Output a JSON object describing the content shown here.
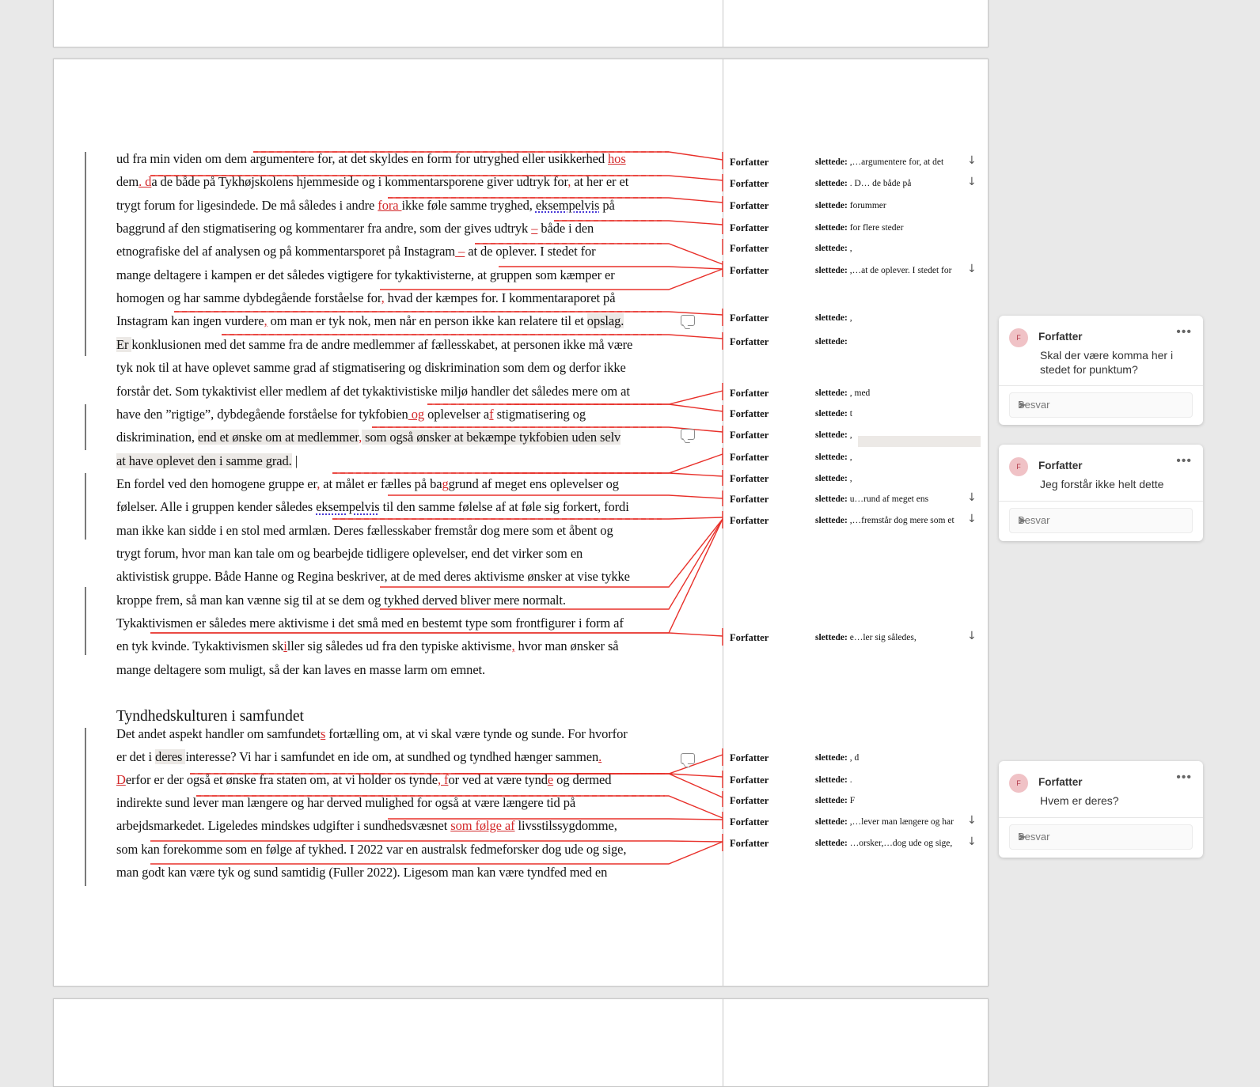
{
  "body_lines": [
    {
      "segs": [
        {
          "t": "ud fra min viden om dem argumentere for, at det skyldes en form for utryghed eller usikkerhed "
        },
        {
          "t": "hos",
          "s": "ins"
        }
      ]
    },
    {
      "segs": [
        {
          "t": "dem"
        },
        {
          "t": ". d",
          "s": "ins"
        },
        {
          "t": "a de både på Tykhøjskolens hjemmeside og i kommentarsporene giver udtryk for"
        },
        {
          "t": ",",
          "s": "ins"
        },
        {
          "t": " at her er et"
        }
      ]
    },
    {
      "segs": [
        {
          "t": "trygt forum for ligesindede. De må således i andre "
        },
        {
          "t": "fora ",
          "s": "ins"
        },
        {
          "t": "ikke føle samme tryghed, "
        },
        {
          "t": "eksempelvis",
          "s": "dot"
        },
        {
          "t": " på"
        }
      ]
    },
    {
      "segs": [
        {
          "t": "baggrund af den stigmatisering og kommentarer fra andre, som der gives udtryk "
        },
        {
          "t": "–",
          "s": "ins"
        },
        {
          "t": " både i den"
        }
      ]
    },
    {
      "segs": [
        {
          "t": "etnografiske del af analysen og på kommentarsporet på Instagram"
        },
        {
          "t": " –",
          "s": "ins"
        },
        {
          "t": " at de oplever. I stedet for"
        }
      ]
    },
    {
      "segs": [
        {
          "t": "mange deltagere i kampen er det således vigtigere for tykaktivisterne, at gruppen som kæmper er"
        }
      ]
    },
    {
      "segs": [
        {
          "t": "homogen og har samme dybdegående forståelse for"
        },
        {
          "t": ",",
          "s": "ins"
        },
        {
          "t": " hvad der kæmpes for. I kommentaraporet på"
        }
      ]
    },
    {
      "segs": [
        {
          "t": "Instagram kan ingen vurdere"
        },
        {
          "t": ",",
          "s": "ins"
        },
        {
          "t": " om man er tyk nok, men når en person ikke kan relatere til et "
        },
        {
          "t": "opslag.",
          "s": "hl"
        }
      ]
    },
    {
      "segs": [
        {
          "t": "Er ",
          "s": "hl"
        },
        {
          "t": "konklusionen med det samme fra de andre medlemmer af fællesskabet, at personen ikke må være"
        }
      ]
    },
    {
      "segs": [
        {
          "t": "tyk nok til at have oplevet samme grad af stigmatisering og diskrimination som dem og derfor ikke"
        }
      ]
    },
    {
      "segs": [
        {
          "t": "forstår det. Som tykaktivist eller medlem af det tykaktivistiske miljø handler det således mere om at"
        }
      ]
    },
    {
      "segs": [
        {
          "t": "have den ”rigtige”, dybdegående forståelse for tykfobien"
        },
        {
          "t": " og",
          "s": "ins"
        },
        {
          "t": " oplevelser a"
        },
        {
          "t": "f",
          "s": "ins"
        },
        {
          "t": " stigmatisering og"
        }
      ]
    },
    {
      "segs": [
        {
          "t": "diskrimination, "
        },
        {
          "t": "end et ønske om at medlemmer",
          "s": "hl"
        },
        {
          "t": ",",
          "s": "ins"
        },
        {
          "t": " som også ønsker at bekæmpe tykfobien uden selv",
          "s": "hl"
        }
      ]
    },
    {
      "segs": [
        {
          "t": "at have oplevet den i samme grad.",
          "s": "hl"
        },
        {
          "t": " |"
        }
      ]
    },
    {
      "segs": [
        {
          "t": "En fordel ved den homogene gruppe er"
        },
        {
          "t": ",",
          "s": "ins"
        },
        {
          "t": " at målet er fælles på ba"
        },
        {
          "t": "g",
          "s": "ins"
        },
        {
          "t": "grund af meget ens oplevelser og"
        }
      ]
    },
    {
      "segs": [
        {
          "t": "følelser. Alle i gruppen kender således "
        },
        {
          "t": "eksempelvis",
          "s": "dot"
        },
        {
          "t": " til den samme følelse af at føle sig forkert, fordi"
        }
      ]
    },
    {
      "segs": [
        {
          "t": "man ikke kan sidde i en stol med armlæn. Deres fællesskaber fremstår dog mere som et åbent og"
        }
      ]
    },
    {
      "segs": [
        {
          "t": "trygt forum, hvor man kan tale om og bearbejde tidligere oplevelser, end det virker som en"
        }
      ]
    },
    {
      "segs": [
        {
          "t": "aktivistisk gruppe. Både Hanne og Regina beskriver, at de med deres aktivisme ønsker at vise tykke"
        }
      ]
    },
    {
      "segs": [
        {
          "t": "kroppe frem, så man kan vænne sig til at se dem og tykhed derved bliver mere normalt."
        }
      ]
    },
    {
      "segs": [
        {
          "t": "Tykaktivismen er således mere aktivisme i det små med en bestemt type som frontfigurer i form af"
        }
      ]
    },
    {
      "segs": [
        {
          "t": "en tyk kvinde. Tykaktivismen sk"
        },
        {
          "t": "i",
          "s": "ins"
        },
        {
          "t": "ller sig således ud fra den typiske aktivisme"
        },
        {
          "t": ",",
          "s": "ins"
        },
        {
          "t": " hvor man ønsker så"
        }
      ]
    },
    {
      "segs": [
        {
          "t": "mange deltagere som muligt, så der kan laves en masse larm om emnet."
        }
      ]
    }
  ],
  "heading": "Tyndhedskulturen i samfundet",
  "body_lines_2": [
    {
      "segs": [
        {
          "t": "Det andet aspekt handler om samfundet"
        },
        {
          "t": "s",
          "s": "ins"
        },
        {
          "t": " fortælling om, at vi skal være tynde og sunde. For hvorfor"
        }
      ]
    },
    {
      "segs": [
        {
          "t": "er det i "
        },
        {
          "t": "deres ",
          "s": "hl"
        },
        {
          "t": "interesse? Vi har i samfundet en ide om, at sundhed og tyndhed hænger sammen"
        },
        {
          "t": ".",
          "s": "ins"
        }
      ]
    },
    {
      "segs": [
        {
          "t": "D",
          "s": "ins"
        },
        {
          "t": "erfor er der også et ønske fra staten om, at vi holder os tynde"
        },
        {
          "t": ", f",
          "s": "ins"
        },
        {
          "t": "or ved at være tynd"
        },
        {
          "t": "e",
          "s": "ins"
        },
        {
          "t": " og dermed"
        }
      ]
    },
    {
      "segs": [
        {
          "t": "indirekte sund lever man længere og har derved mulighed for også at være længere tid på"
        }
      ]
    },
    {
      "segs": [
        {
          "t": "arbejdsmarkedet. Ligeledes mindskes udgifter i sundhedsvæsnet "
        },
        {
          "t": "som følge af",
          "s": "ins"
        },
        {
          "t": " livsstilssygdomme,"
        }
      ]
    },
    {
      "segs": [
        {
          "t": "som kan forekomme som en følge af tykhed. I 2022 var en australsk fedmeforsker dog ude og sige,"
        }
      ]
    },
    {
      "segs": [
        {
          "t": "man godt kan være tyk og sund samtidig (Fuller 2022). Ligesom man kan være tyndfed med en"
        }
      ]
    }
  ],
  "balloons": [
    {
      "author": "Forfatter",
      "label": "slettede:",
      "text": ",…argumentere for, at det",
      "arrow": true
    },
    {
      "author": "Forfatter",
      "label": "slettede:",
      "text": ". D… de både på",
      "arrow": true
    },
    {
      "author": "Forfatter",
      "label": "slettede:",
      "text": "forummer",
      "arrow": false
    },
    {
      "author": "Forfatter",
      "label": "slettede:",
      "text": " for flere steder",
      "arrow": false
    },
    {
      "author": "Forfatter",
      "label": "slettede:",
      "text": ",",
      "arrow": false
    },
    {
      "author": "Forfatter",
      "label": "slettede:",
      "text": ",…at de oplever. I stedet for",
      "arrow": true
    },
    {
      "author": "Forfatter",
      "label": "slettede:",
      "text": ",",
      "arrow": false
    },
    {
      "author": "Forfatter",
      "label": "slettede:",
      "text": "",
      "arrow": false
    },
    {
      "author": "Forfatter",
      "label": "slettede:",
      "text": ", med",
      "arrow": false
    },
    {
      "author": "Forfatter",
      "label": "slettede:",
      "text": "t",
      "arrow": false
    },
    {
      "author": "Forfatter",
      "label": "slettede:",
      "text": ",",
      "arrow": false
    },
    {
      "author": "Forfatter",
      "label": "slettede:",
      "text": ",",
      "arrow": false
    },
    {
      "author": "Forfatter",
      "label": "slettede:",
      "text": ",",
      "arrow": false
    },
    {
      "author": "Forfatter",
      "label": "slettede:",
      "text": "u…rund af meget ens",
      "arrow": true
    },
    {
      "author": "Forfatter",
      "label": "slettede:",
      "text": ",…fremstår dog mere som et",
      "arrow": true
    },
    {
      "author": "Forfatter",
      "label": "slettede:",
      "text": "e…ler sig således,",
      "arrow": true
    },
    {
      "author": "Forfatter",
      "label": "slettede:",
      "text": ", d",
      "arrow": false
    },
    {
      "author": "Forfatter",
      "label": "slettede:",
      "text": ".",
      "arrow": false
    },
    {
      "author": "Forfatter",
      "label": "slettede:",
      "text": "F",
      "arrow": false
    },
    {
      "author": "Forfatter",
      "label": "slettede:",
      "text": ",…lever man længere og har",
      "arrow": true
    },
    {
      "author": "Forfatter",
      "label": "slettede:",
      "text": " …orsker,…dog ude og sige,",
      "arrow": true
    }
  ],
  "comments": [
    {
      "avatar": "F",
      "author": "Forfatter",
      "menu": "•••",
      "text": "Skal der være komma her i stedet for punktum?",
      "reply_placeholder": "Besvar"
    },
    {
      "avatar": "F",
      "author": "Forfatter",
      "menu": "•••",
      "text": "Jeg forstår ikke helt dette",
      "reply_placeholder": "Besvar"
    },
    {
      "avatar": "F",
      "author": "Forfatter",
      "menu": "•••",
      "text": "Hvem er deres?",
      "reply_placeholder": "Besvar"
    }
  ],
  "icons": {
    "arrow": "arrow-down-icon",
    "comment": "comment-bubble-icon",
    "send": "send-icon"
  },
  "colors": {
    "insertion": "#d3292b",
    "connector": "#e8302a",
    "background": "#e9e9e9",
    "avatar": "#f0c2c6"
  }
}
